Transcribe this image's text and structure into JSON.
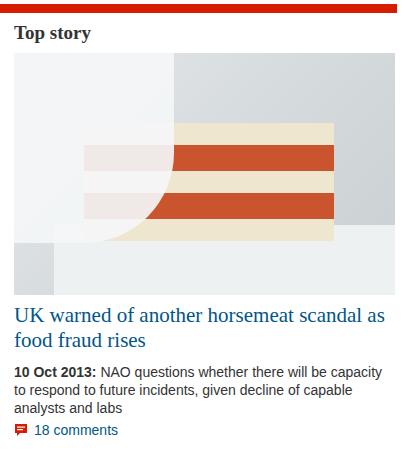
{
  "section": {
    "title": "Top story"
  },
  "story": {
    "headline": "UK warned of another horsemeat scandal as food fraud rises",
    "date": "10 Oct 2013:",
    "summary": "NAO questions whether there will be capacity to respond to future incidents, given decline of capable analysts and labs",
    "comments": "18 comments"
  }
}
